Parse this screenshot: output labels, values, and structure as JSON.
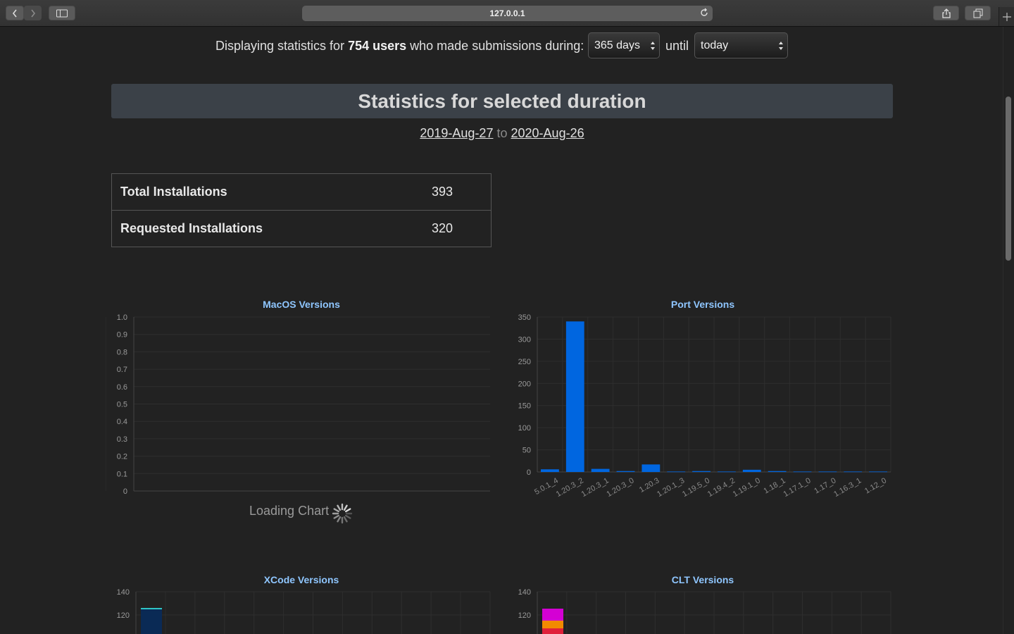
{
  "browser": {
    "url": "127.0.0.1"
  },
  "filter": {
    "prefix": "Displaying statistics for ",
    "users": "754 users",
    "suffix": " who made submissions during:",
    "duration_value": "365 days",
    "until_label": "until",
    "until_value": "today"
  },
  "header": {
    "title": "Statistics for selected duration"
  },
  "date_range": {
    "start": "2019-Aug-27",
    "separator": "to",
    "end": "2020-Aug-26"
  },
  "stats": [
    {
      "label": "Total Installations",
      "value": "393"
    },
    {
      "label": "Requested Installations",
      "value": "320"
    }
  ],
  "loading_text": "Loading Chart",
  "colors": {
    "bar_blue": "#0066e0",
    "title_blue": "#8fc6ff",
    "xcode_bar": "#0a2a55",
    "xcode_top": "#2fc5c5",
    "clt_magenta": "#d400d4",
    "clt_orange": "#f28a00",
    "clt_red": "#e0203a"
  },
  "chart_data": [
    {
      "type": "bar",
      "title": "MacOS Versions",
      "categories": [],
      "values": [],
      "ylim": [
        0,
        1.0
      ],
      "yticks": [
        "1.0",
        "0.9",
        "0.8",
        "0.7",
        "0.6",
        "0.5",
        "0.4",
        "0.3",
        "0.2",
        "0.1",
        "0"
      ],
      "grid": true
    },
    {
      "type": "bar",
      "title": "Port Versions",
      "categories": [
        "5.0.1_4",
        "1.20.3_2",
        "1.20.3_1",
        "1.20.3_0",
        "1.20.3",
        "1.20.1_3",
        "1.19.5_0",
        "1.19.4_2",
        "1.19.1_0",
        "1.18_1",
        "1.17.1_0",
        "1.17_0",
        "1.16.3_1",
        "1.12_0"
      ],
      "values": [
        6,
        340,
        7,
        2,
        17,
        1,
        2,
        1,
        5,
        2,
        1,
        1,
        1,
        1
      ],
      "ylim": [
        0,
        350
      ],
      "yticks": [
        "350",
        "300",
        "250",
        "200",
        "150",
        "100",
        "50",
        "0"
      ],
      "grid": true
    },
    {
      "type": "bar",
      "title": "XCode Versions",
      "categories": [],
      "values": [],
      "ylim": [
        0,
        140
      ],
      "yticks": [
        "140",
        "120"
      ],
      "grid": true
    },
    {
      "type": "bar",
      "title": "CLT Versions",
      "categories": [],
      "values": [],
      "ylim": [
        0,
        140
      ],
      "yticks": [
        "140",
        "120"
      ],
      "grid": true
    }
  ]
}
